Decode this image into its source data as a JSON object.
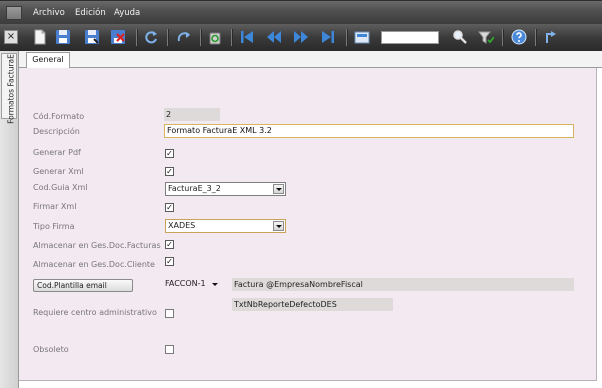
{
  "menu": {
    "items": [
      "Archivo",
      "Edición",
      "Ayuda"
    ]
  },
  "toolbar": {
    "close_label": "×",
    "icons": [
      "new-document-icon",
      "save-icon",
      "save-as-icon",
      "delete-icon",
      "refresh-icon",
      "redo-icon",
      "recycle-icon",
      "first-record-icon",
      "previous-page-icon",
      "next-page-icon",
      "last-record-icon",
      "image-view-icon",
      "search-icon",
      "filter-icon",
      "help-icon",
      "exit-icon"
    ],
    "search_value": ""
  },
  "left_strip": {
    "tab_label": "Formatos FacturaE"
  },
  "tabs": [
    {
      "label": "General"
    }
  ],
  "form": {
    "cod_formato": {
      "label": "Cód.Formato",
      "value": "2"
    },
    "descripcion": {
      "label": "Descripción",
      "value": "Formato FacturaE XML 3.2"
    },
    "generar_pdf": {
      "label": "Generar Pdf",
      "checked": true
    },
    "generar_xml": {
      "label": "Generar Xml",
      "checked": true
    },
    "cod_guia_xml": {
      "label": "Cod.Guia Xml",
      "value": "FacturaE_3_2"
    },
    "firmar_xml": {
      "label": "Firmar Xml",
      "checked": true
    },
    "tipo_firma": {
      "label": "Tipo Firma",
      "value": "XADES"
    },
    "almacenar_facturas": {
      "label": "Almacenar en Ges.Doc.Facturas",
      "checked": true
    },
    "almacenar_cliente": {
      "label": "Almacenar en Ges.Doc.Cliente",
      "checked": true
    },
    "plantilla_email": {
      "button_label": "Cod.Plantilla email",
      "code": "FACCON-1",
      "subject": "Factura @EmpresaNombreFiscal",
      "report": "TxtNbReporteDefectoDES"
    },
    "requiere_centro": {
      "label": "Requiere centro administrativo",
      "checked": false
    },
    "obsoleto": {
      "label": "Obsoleto",
      "checked": false
    }
  },
  "colors": {
    "panel_bg": "#f3e9f1",
    "focus_border": "#d7b461",
    "menubar_bg": "#505050"
  },
  "check_glyph": "✓"
}
